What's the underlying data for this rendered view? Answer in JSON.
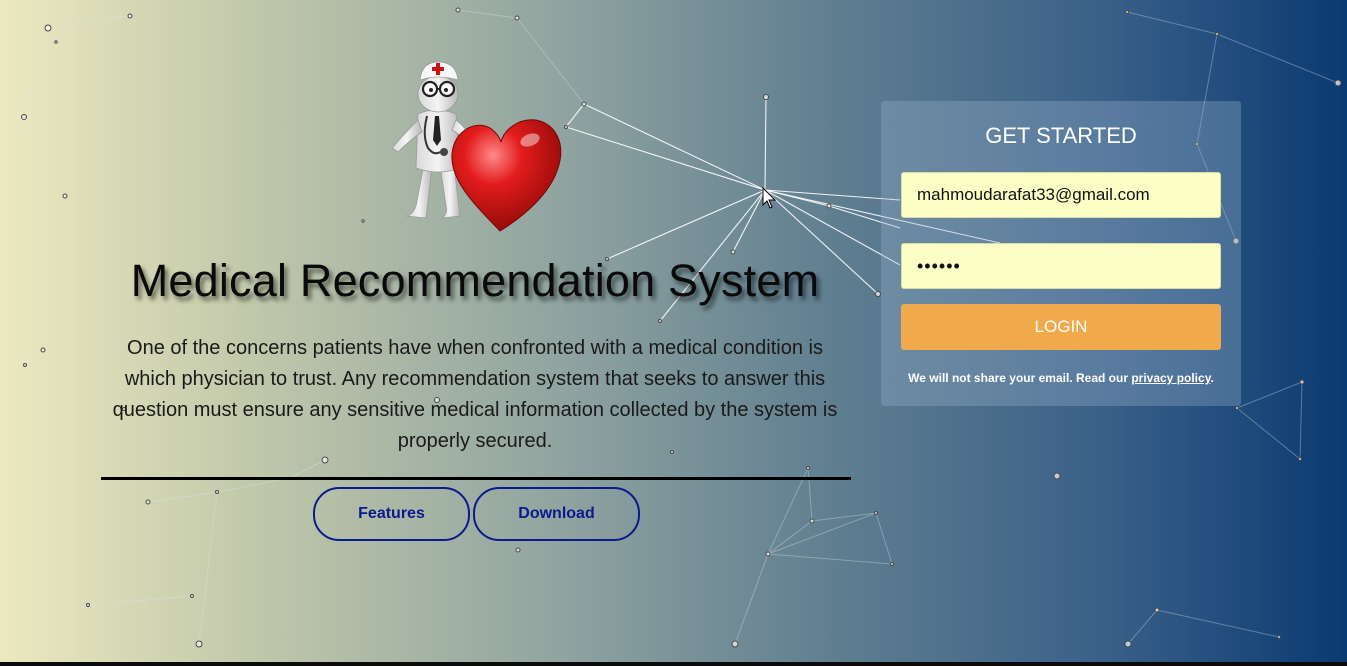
{
  "hero": {
    "title": "Medical Recommendation System",
    "description": "One of the concerns patients have when confronted with a medical condition is which physician to trust. Any recommendation system that seeks to answer this question must ensure any sensitive medical information collected by the system is properly secured.",
    "buttons": {
      "features": "Features",
      "download": "Download"
    },
    "image_icon": "doctor-with-heart-icon"
  },
  "login": {
    "title": "GET STARTED",
    "email_value": "mahmoudarafat33@gmail.com",
    "password_value": "••••••",
    "button_label": "LOGIN",
    "note_prefix": "We will not share your email. Read our ",
    "note_link": "privacy policy",
    "note_suffix": "."
  },
  "colors": {
    "background_left": "#ece9c0",
    "background_right": "#0a3a72",
    "button_outline": "#0c1a8c",
    "login_button": "#f0aa4c",
    "input_background": "#fbffc6"
  }
}
